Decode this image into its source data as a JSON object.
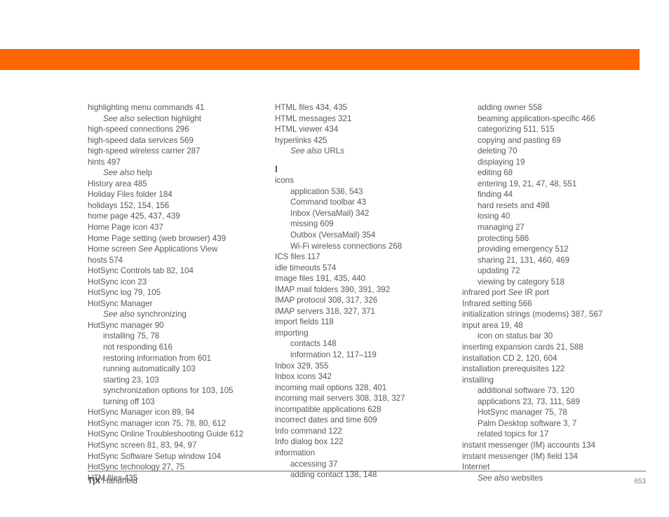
{
  "document": {
    "kind": "index-page",
    "page_number": "653",
    "footer_brand": "T|X",
    "footer_title_rest": " Handheld",
    "accent_color": "#ff6600",
    "text_color": "#59595b"
  },
  "columns": [
    {
      "id": "column-1",
      "entries": [
        {
          "level": 1,
          "text": "highlighting menu commands 41"
        },
        {
          "level": 2,
          "italic_prefix": "See also",
          "text": " selection highlight"
        },
        {
          "level": 1,
          "text": "high-speed connections 296"
        },
        {
          "level": 1,
          "text": "high-speed data services 569"
        },
        {
          "level": 1,
          "text": "high-speed wireless carrier 287"
        },
        {
          "level": 1,
          "text": "hints 497"
        },
        {
          "level": 2,
          "italic_prefix": "See also",
          "text": " help"
        },
        {
          "level": 1,
          "text": "History area 485"
        },
        {
          "level": 1,
          "text": "Holiday Files folder 184"
        },
        {
          "level": 1,
          "text": "holidays 152, 154, 156"
        },
        {
          "level": 1,
          "text": "home page 425, 437, 439"
        },
        {
          "level": 1,
          "text": "Home Page icon 437"
        },
        {
          "level": 1,
          "text": "Home Page setting (web browser) 439"
        },
        {
          "level": 1,
          "text_before_italic": "Home screen ",
          "italic_mid": "See",
          "text": " Applications View"
        },
        {
          "level": 1,
          "text": "hosts 574"
        },
        {
          "level": 1,
          "text": "HotSync Controls tab 82, 104"
        },
        {
          "level": 1,
          "text": "HotSync icon 23"
        },
        {
          "level": 1,
          "text": "HotSync log 79, 105"
        },
        {
          "level": 1,
          "text": "HotSync Manager"
        },
        {
          "level": 2,
          "italic_prefix": "See also",
          "text": " synchronizing"
        },
        {
          "level": 1,
          "text": "HotSync manager 90"
        },
        {
          "level": 2,
          "text": "installing 75, 78"
        },
        {
          "level": 2,
          "text": "not responding 616"
        },
        {
          "level": 2,
          "text": "restoring information from 601"
        },
        {
          "level": 2,
          "text": "running automatically 103"
        },
        {
          "level": 2,
          "text": "starting 23, 103"
        },
        {
          "level": 2,
          "text": "synchronization options for 103, 105"
        },
        {
          "level": 2,
          "text": "turning off 103"
        },
        {
          "level": 1,
          "text": "HotSync Manager icon 89, 94"
        },
        {
          "level": 1,
          "text": "HotSync manager icon 75, 78, 80, 612"
        },
        {
          "level": 1,
          "text": "HotSync Online Troubleshooting Guide 612"
        },
        {
          "level": 1,
          "text": "HotSync screen 81, 83, 94, 97"
        },
        {
          "level": 1,
          "text": "HotSync Software Setup window 104"
        },
        {
          "level": 1,
          "text": "HotSync technology 27, 75"
        },
        {
          "level": 1,
          "text": "HTM files 435"
        }
      ]
    },
    {
      "id": "column-2",
      "entries": [
        {
          "level": 1,
          "text": "HTML files 434, 435"
        },
        {
          "level": 1,
          "text": "HTML messages 321"
        },
        {
          "level": 1,
          "text": "HTML viewer 434"
        },
        {
          "level": 1,
          "text": "hyperlinks 425"
        },
        {
          "level": 2,
          "italic_prefix": "See also",
          "text": " URLs"
        },
        {
          "level": 0,
          "heading": "I"
        },
        {
          "level": 1,
          "text": "icons"
        },
        {
          "level": 2,
          "text": "application 536, 543"
        },
        {
          "level": 2,
          "text": "Command toolbar 43"
        },
        {
          "level": 2,
          "text": "Inbox (VersaMail) 342"
        },
        {
          "level": 2,
          "text": "missing 609"
        },
        {
          "level": 2,
          "text": "Outbox (VersaMail) 354"
        },
        {
          "level": 2,
          "text": "Wi-Fi wireless connections 268"
        },
        {
          "level": 1,
          "text": "ICS files 117"
        },
        {
          "level": 1,
          "text": "idle timeouts 574"
        },
        {
          "level": 1,
          "text": "image files 191, 435, 440"
        },
        {
          "level": 1,
          "text": "IMAP mail folders 390, 391, 392"
        },
        {
          "level": 1,
          "text": "IMAP protocol 308, 317, 326"
        },
        {
          "level": 1,
          "text": "IMAP servers 318, 327, 371"
        },
        {
          "level": 1,
          "text": "import fields 118"
        },
        {
          "level": 1,
          "text": "importing"
        },
        {
          "level": 2,
          "text": "contacts 148"
        },
        {
          "level": 2,
          "text": "information 12, 117–119"
        },
        {
          "level": 1,
          "text": "Inbox 329, 355"
        },
        {
          "level": 1,
          "text": "Inbox icons 342"
        },
        {
          "level": 1,
          "text": "incoming mail options 328, 401"
        },
        {
          "level": 1,
          "text": "incoming mail servers 308, 318, 327"
        },
        {
          "level": 1,
          "text": "incompatible applications 628"
        },
        {
          "level": 1,
          "text": "incorrect dates and time 609"
        },
        {
          "level": 1,
          "text": "Info command 122"
        },
        {
          "level": 1,
          "text": "Info dialog box 122"
        },
        {
          "level": 1,
          "text": "information"
        },
        {
          "level": 2,
          "text": "accessing 37"
        },
        {
          "level": 2,
          "text": "adding contact 138, 148"
        }
      ]
    },
    {
      "id": "column-3",
      "entries": [
        {
          "level": 2,
          "text": "adding owner 558"
        },
        {
          "level": 2,
          "text": "beaming application-specific 466"
        },
        {
          "level": 2,
          "text": "categorizing 511, 515"
        },
        {
          "level": 2,
          "text": "copying and pasting 69"
        },
        {
          "level": 2,
          "text": "deleting 70"
        },
        {
          "level": 2,
          "text": "displaying 19"
        },
        {
          "level": 2,
          "text": "editing 68"
        },
        {
          "level": 2,
          "text": "entering 19, 21, 47, 48, 551"
        },
        {
          "level": 2,
          "text": "finding 44"
        },
        {
          "level": 2,
          "text": "hard resets and 498"
        },
        {
          "level": 2,
          "text": "losing 40"
        },
        {
          "level": 2,
          "text": "managing 27"
        },
        {
          "level": 2,
          "text": "protecting 586"
        },
        {
          "level": 2,
          "text": "providing emergency 512"
        },
        {
          "level": 2,
          "text": "sharing 21, 131, 460, 469"
        },
        {
          "level": 2,
          "text": "updating 72"
        },
        {
          "level": 2,
          "text": "viewing by category 518"
        },
        {
          "level": 1,
          "text_before_italic": "infrared port ",
          "italic_mid": "See",
          "text": " IR port"
        },
        {
          "level": 1,
          "text": "Infrared setting 566"
        },
        {
          "level": 1,
          "text": "initialization strings (modems) 387, 567"
        },
        {
          "level": 1,
          "text": "input area 19, 48"
        },
        {
          "level": 2,
          "text": "icon on status bar 30"
        },
        {
          "level": 1,
          "text": "inserting expansion cards 21, 588"
        },
        {
          "level": 1,
          "text": "installation CD 2, 120, 604"
        },
        {
          "level": 1,
          "text": "installation prerequisites 122"
        },
        {
          "level": 1,
          "text": "installing"
        },
        {
          "level": 2,
          "text": "additional software 73, 120"
        },
        {
          "level": 2,
          "text": "applications 23, 73, 111, 589"
        },
        {
          "level": 2,
          "text": "HotSync manager 75, 78"
        },
        {
          "level": 2,
          "text": "Palm Desktop software 3, 7"
        },
        {
          "level": 2,
          "text": "related topics for 17"
        },
        {
          "level": 1,
          "text": "instant messenger (IM) accounts 134"
        },
        {
          "level": 1,
          "text": "instant messenger (IM) field 134"
        },
        {
          "level": 1,
          "text": "Internet"
        },
        {
          "level": 2,
          "italic_prefix": "See also",
          "text": " websites"
        }
      ]
    }
  ]
}
